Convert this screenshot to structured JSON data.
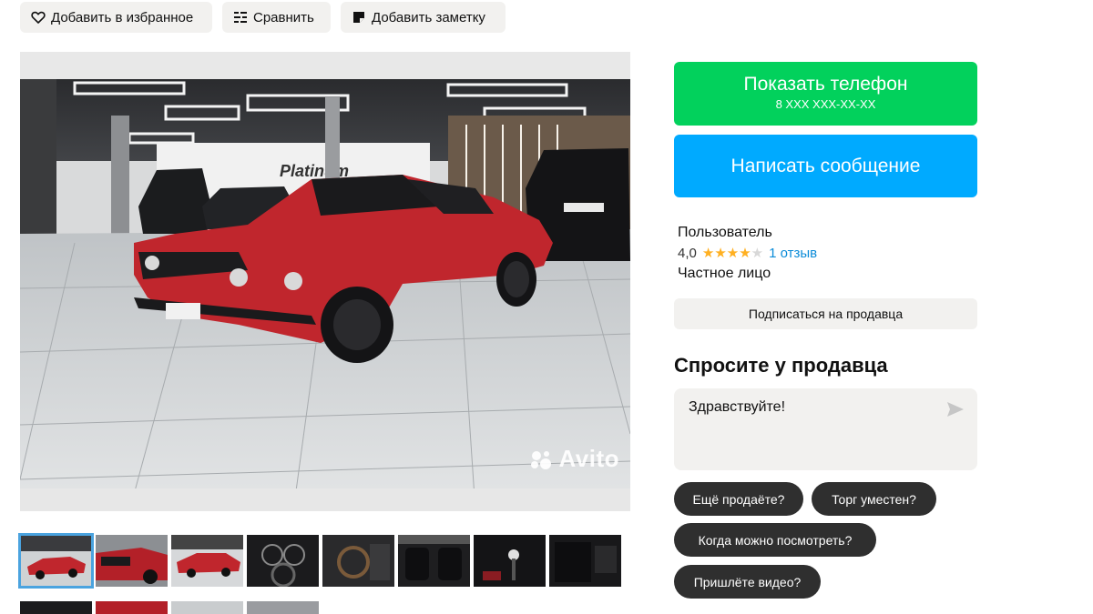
{
  "actions": {
    "favorite": "Добавить в избранное",
    "compare": "Сравнить",
    "note": "Добавить заметку"
  },
  "gallery": {
    "watermark": "Avito",
    "thumbnails": [
      "photo-1",
      "photo-2",
      "photo-3",
      "photo-4",
      "photo-5",
      "photo-6",
      "photo-7",
      "photo-8"
    ]
  },
  "contact": {
    "show_phone": "Показать телефон",
    "phone_masked": "8 XXX XXX-XX-XX",
    "write_message": "Написать сообщение"
  },
  "seller": {
    "name": "Пользователь",
    "rating_value": "4,0",
    "rating_stars": 4,
    "rating_max": 5,
    "reviews": "1 отзыв",
    "type": "Частное лицо",
    "subscribe": "Подписаться на продавца"
  },
  "ask": {
    "title": "Спросите у продавца",
    "message": "Здравствуйте!",
    "chips": [
      "Ещё продаёте?",
      "Торг уместен?",
      "Когда можно посмотреть?",
      "Пришлёте видео?"
    ]
  },
  "colors": {
    "phone_button": "#02d15c",
    "message_button": "#00aaff",
    "star": "#ffb021",
    "link": "#0a8bd8",
    "chip": "#2f2f2f"
  }
}
